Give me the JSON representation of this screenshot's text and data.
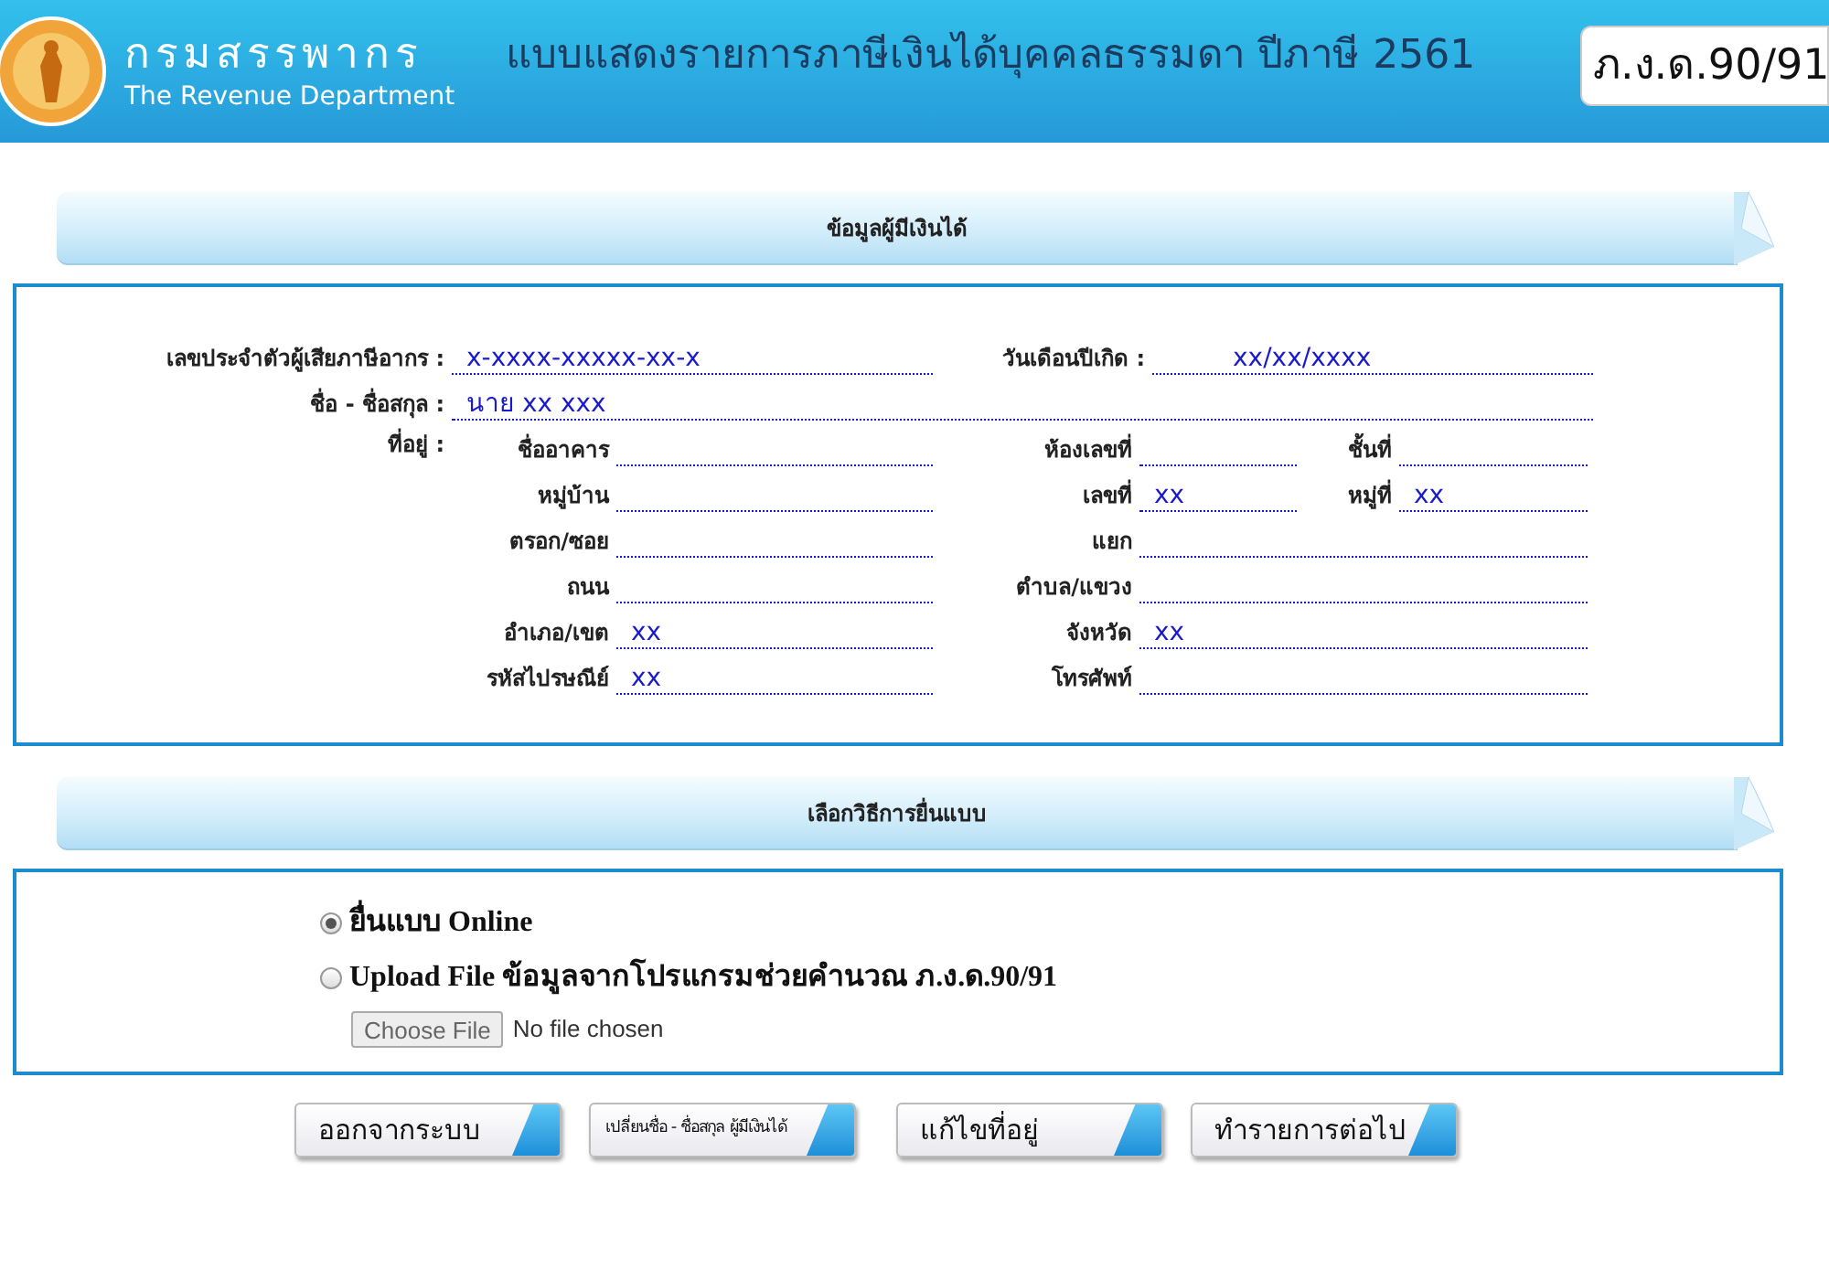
{
  "header": {
    "title_th": "กรมสรรพากร",
    "title_en": "The Revenue Department",
    "form_title": "แบบแสดงรายการภาษีเงินได้บุคคลธรรมดา ปีภาษี 2561",
    "form_code": "ภ.ง.ด.90/91"
  },
  "taxpayer": {
    "heading": "ข้อมูลผู้มีเงินได้",
    "tax_id": {
      "label": "เลขประจำตัวผู้เสียภาษีอากร :",
      "value": "x-xxxx-xxxxx-xx-x"
    },
    "birth_date": {
      "label": "วันเดือนปีเกิด :",
      "value": "xx/xx/xxxx"
    },
    "name": {
      "label": "ชื่อ - ชื่อสกุล :",
      "value": "นาย xx xxx"
    },
    "address_label": "ที่อยู่ :",
    "address_rows": [
      [
        {
          "label": "ชื่ออาคาร"
        },
        {
          "label": "ห้องเลขที่"
        },
        {
          "label": "ชั้นที่"
        }
      ],
      [
        {
          "label": "หมู่บ้าน"
        },
        {
          "label": "เลขที่",
          "value": "xx"
        },
        {
          "label": "หมู่ที่",
          "value": "xx"
        }
      ],
      [
        {
          "label": "ตรอก/ซอย"
        },
        {
          "label": "แยก"
        }
      ],
      [
        {
          "label": "ถนน"
        },
        {
          "label": "ตำบล/แขวง"
        }
      ],
      [
        {
          "label": "อำเภอ/เขต",
          "value": "xx"
        },
        {
          "label": "จังหวัด",
          "value": "xx"
        }
      ],
      [
        {
          "label": "รหัสไปรษณีย์",
          "value": "xx"
        },
        {
          "label": "โทรศัพท์"
        }
      ]
    ]
  },
  "filing": {
    "heading": "เลือกวิธีการยื่นแบบ",
    "options": [
      {
        "label": "ยื่นแบบ Online",
        "selected": true
      },
      {
        "label": "Upload File ข้อมูลจากโปรแกรมช่วยคำนวณ ภ.ง.ด.90/91",
        "selected": false
      }
    ],
    "file_button": "Choose File",
    "file_status": "No file chosen"
  },
  "buttons": [
    "ออกจากระบบ",
    "เปลี่ยนชื่อ - ชื่อสกุล ผู้มีเงินได้",
    "แก้ไขที่อยู่",
    "ทำรายการต่อไป"
  ]
}
